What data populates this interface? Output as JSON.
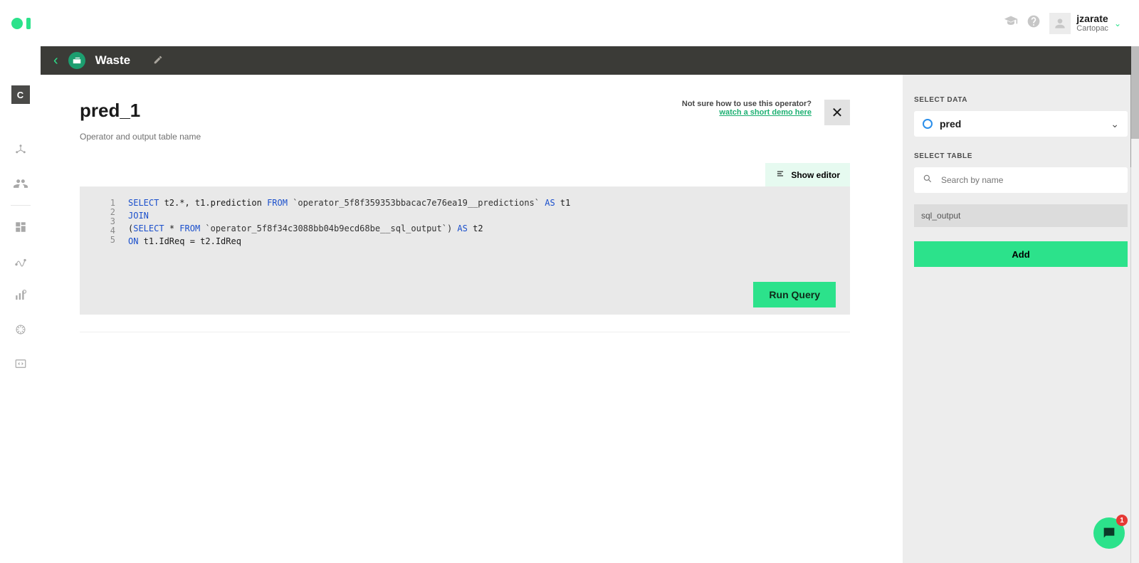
{
  "header": {
    "user_name": "jzarate",
    "user_org": "Cartopac"
  },
  "project_bar": {
    "title": "Waste"
  },
  "sidebar": {
    "top_letter": "C"
  },
  "main": {
    "title": "pred_1",
    "subtitle": "Operator and output table name",
    "demo_prompt": "Not sure how to use this operator?",
    "demo_link": "watch a short demo here",
    "show_editor_label": "Show editor",
    "run_query_label": "Run Query",
    "sql": {
      "line1_select": "SELECT",
      "line1_mid": " t2.*, t1.prediction ",
      "line1_from": "FROM",
      "line1_tbl": " `operator_5f8f359353bbacac7e76ea19__predictions` ",
      "line1_as": "AS",
      "line1_alias": " t1",
      "line2_join": "JOIN",
      "line3_open": "(",
      "line3_select": "SELECT",
      "line3_star": " * ",
      "line3_from": "FROM",
      "line3_tbl": " `operator_5f8f34c3088bb04b9ecd68be__sql_output`) ",
      "line3_as": "AS",
      "line3_alias": " t2",
      "line4_on": "ON",
      "line4_cond": " t1.IdReq = t2.IdReq",
      "gutter": [
        "1",
        "2",
        "3",
        "4",
        "5"
      ]
    }
  },
  "right_panel": {
    "select_data_label": "SELECT DATA",
    "selected_data": "pred",
    "select_table_label": "SELECT TABLE",
    "search_placeholder": "Search by name",
    "table_item": "sql_output",
    "add_label": "Add"
  },
  "chat": {
    "badge": "1"
  }
}
